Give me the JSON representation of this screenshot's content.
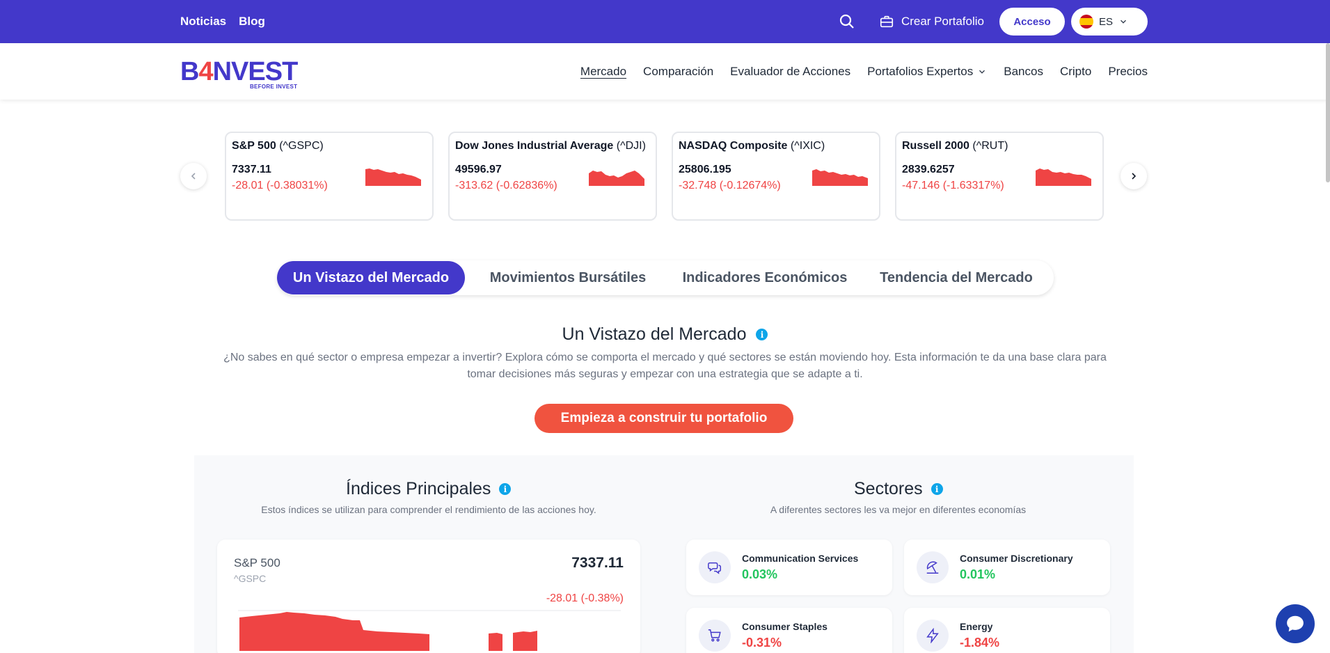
{
  "topbar": {
    "links": [
      "Noticias",
      "Blog"
    ],
    "create_portfolio": "Crear Portafolio",
    "login": "Acceso",
    "lang": "ES"
  },
  "logo": {
    "brand_a": "B",
    "brand_4": "4",
    "brand_b": "NVEST",
    "tagline": "BEFORE INVEST"
  },
  "nav": {
    "items": [
      "Mercado",
      "Comparación",
      "Evaluador de Acciones",
      "Portafolios Expertos",
      "Bancos",
      "Cripto",
      "Precios"
    ]
  },
  "tickers": [
    {
      "name": "S&P 500",
      "symbol": "(^GSPC)",
      "price": "7337.11",
      "change": "-28.01 (-0.38031%)"
    },
    {
      "name": "Dow Jones Industrial Average",
      "symbol": "(^DJI)",
      "price": "49596.97",
      "change": "-313.62 (-0.62836%)"
    },
    {
      "name": "NASDAQ Composite",
      "symbol": "(^IXIC)",
      "price": "25806.195",
      "change": "-32.748 (-0.12674%)"
    },
    {
      "name": "Russell 2000",
      "symbol": "(^RUT)",
      "price": "2839.6257",
      "change": "-47.146 (-1.63317%)"
    }
  ],
  "tabs": [
    "Un Vistazo del Mercado",
    "Movimientos Bursátiles",
    "Indicadores Económicos",
    "Tendencia del Mercado"
  ],
  "intro": {
    "title": "Un Vistazo del Mercado",
    "description": "¿No sabes en qué sector o empresa empezar a invertir? Explora cómo se comporta el mercado y qué sectores se están moviendo hoy. Esta información te da una base clara para tomar decisiones más seguras y empezar con una estrategia que se adapte a ti.",
    "cta": "Empieza a construir tu portafolio"
  },
  "indices": {
    "title": "Índices Principales",
    "subtitle": "Estos índices se utilizan para comprender el rendimiento de las acciones hoy.",
    "card": {
      "name": "S&P 500",
      "symbol": "^GSPC",
      "price": "7337.11",
      "change": "-28.01 (-0.38%)"
    }
  },
  "sectors": {
    "title": "Sectores",
    "subtitle": "A diferentes sectores les va mejor en diferentes economías",
    "items": [
      {
        "name": "Communication Services",
        "change": "0.03%",
        "icon": "chat-bubbles-icon"
      },
      {
        "name": "Consumer Discretionary",
        "change": "0.01%",
        "icon": "beach-umbrella-icon"
      },
      {
        "name": "Consumer Staples",
        "change": "-0.31%",
        "icon": "shopping-cart-icon"
      },
      {
        "name": "Energy",
        "change": "-1.84%",
        "icon": "lightning-icon"
      }
    ]
  },
  "colors": {
    "brand": "#4338ca",
    "accent": "#f0533f",
    "negative": "#ef4444",
    "positive": "#22c55e"
  }
}
